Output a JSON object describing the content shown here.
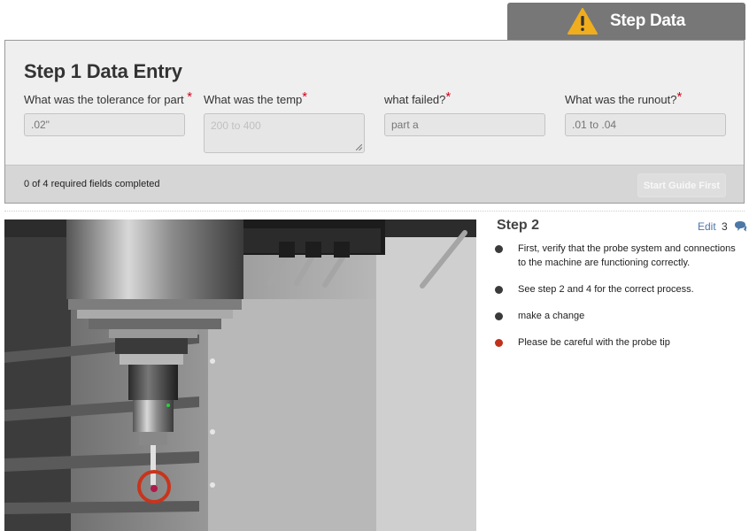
{
  "tab": {
    "title": "Step Data",
    "icon": "warning-icon",
    "icon_color": "#f0ad1e"
  },
  "data_entry": {
    "title": "Step 1 Data Entry",
    "fields": [
      {
        "label": "What was the tolerance for part",
        "placeholder": ".02\"",
        "required": true
      },
      {
        "label": "What was the temp",
        "placeholder": "200 to 400",
        "required": true
      },
      {
        "label": "what failed?",
        "placeholder": "part a",
        "required": true
      },
      {
        "label": "What was the runout?",
        "placeholder": ".01 to .04",
        "required": true
      }
    ],
    "progress_text": "0 of 4 required fields completed",
    "start_button": "Start Guide First"
  },
  "step2": {
    "title": "Step 2",
    "edit_label": "Edit",
    "comment_count": "3",
    "bullets": [
      {
        "text": "First, verify that the probe system and connections to the machine are functioning correctly.",
        "color": "#3a3a3a"
      },
      {
        "text": "See step 2 and 4 for the correct process.",
        "color": "#3a3a3a"
      },
      {
        "text": "make a change",
        "color": "#3a3a3a"
      },
      {
        "text": "Please be careful with the probe tip",
        "color": "#c0311b"
      }
    ]
  },
  "colors": {
    "required": "#d0021b",
    "link": "#4d77a6",
    "tab_bg": "#777777"
  }
}
